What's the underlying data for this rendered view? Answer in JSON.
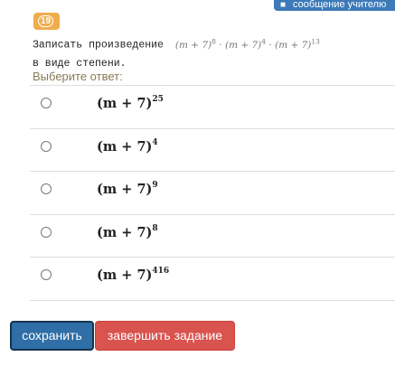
{
  "header": {
    "message_button_label": "сообщение  учителю"
  },
  "question": {
    "number": "19",
    "text_line1": "Записать произведение",
    "expression": {
      "base": "(m + 7)",
      "exponents": [
        "8",
        "4",
        "13"
      ]
    },
    "text_line2": "в виде степени."
  },
  "prompt": "Выберите ответ:",
  "options": [
    {
      "base": "(m + 7)",
      "exponent": "25"
    },
    {
      "base": "(m + 7)",
      "exponent": "4"
    },
    {
      "base": "(m + 7)",
      "exponent": "9"
    },
    {
      "base": "(m + 7)",
      "exponent": "8"
    },
    {
      "base": "(m + 7)",
      "exponent": "416"
    }
  ],
  "buttons": {
    "save_label": "сохранить",
    "finish_label": "завершить задание"
  },
  "colors": {
    "primary": "#2f6ea6",
    "danger": "#d9534f",
    "badge": "#f0ad4e",
    "message": "#3c7ab8"
  }
}
